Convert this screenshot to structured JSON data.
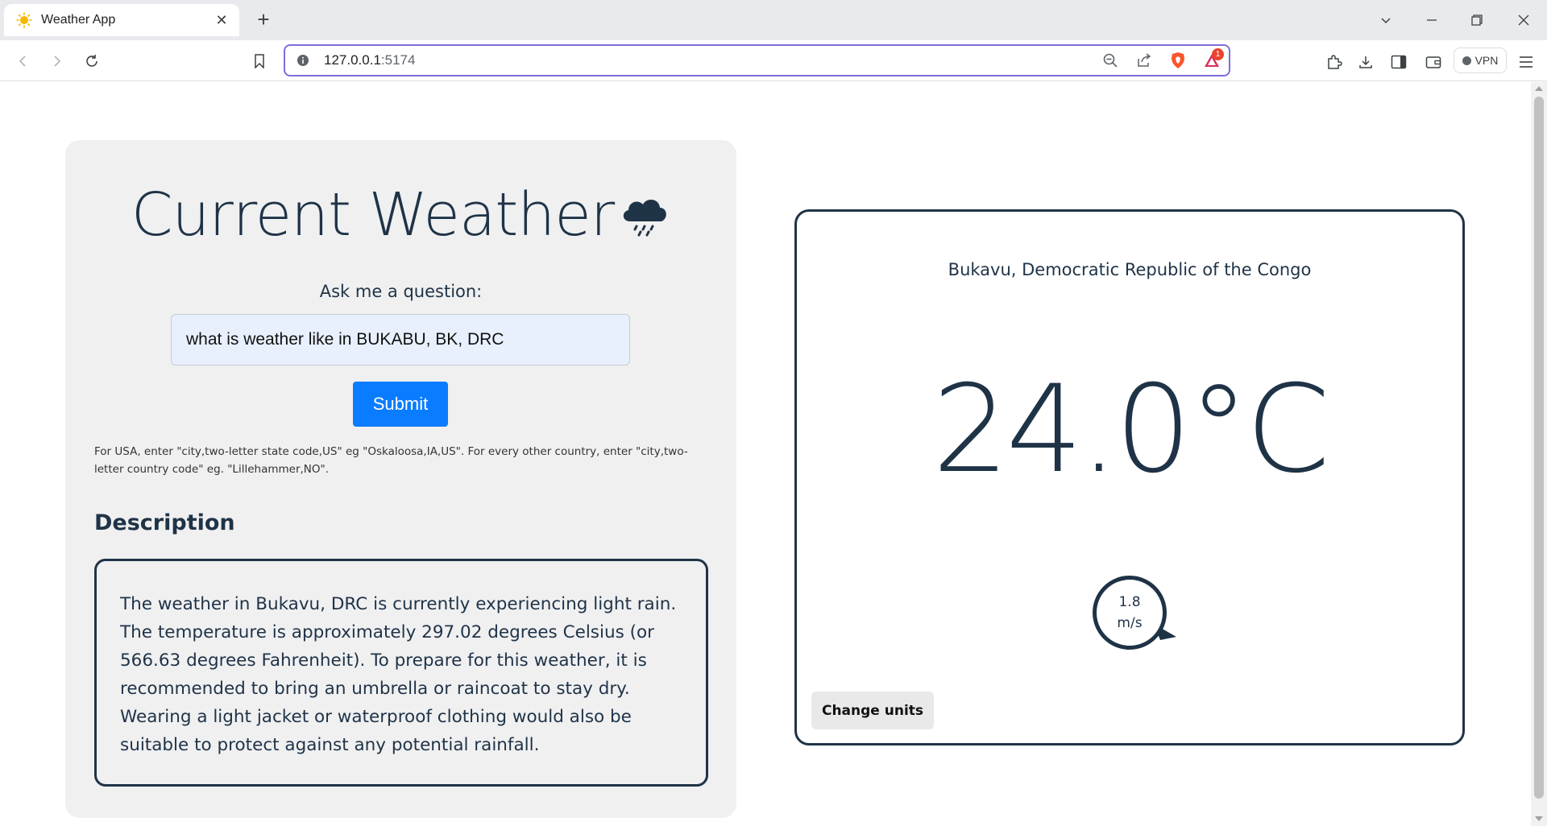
{
  "browser": {
    "tab_title": "Weather App",
    "tab_icon": "sun-icon",
    "new_tab_label": "+",
    "url_host": "127.0.0.1",
    "url_port": ":5174",
    "shield_badge_count": "1",
    "vpn_label": "VPN"
  },
  "page": {
    "heading": "Current Weather",
    "heading_icon": "rain-cloud-icon",
    "ask_label": "Ask me a question:",
    "question_value": "what is weather like in BUKABU, BK, DRC",
    "submit_label": "Submit",
    "hint": "For USA, enter \"city,two-letter state code,US\" eg \"Oskaloosa,IA,US\". For every other country, enter \"city,two-letter country code\" eg. \"Lillehammer,NO\".",
    "description_title": "Description",
    "description_text": "The weather in Bukavu, DRC is currently experiencing light rain. The temperature is approximately 297.02 degrees Celsius (or 566.63 degrees Fahrenheit). To prepare for this weather, it is recommended to bring an umbrella or raincoat to stay dry. Wearing a light jacket or waterproof clothing would also be suitable to protect against any potential rainfall."
  },
  "weather": {
    "location": "Bukavu, Democratic Republic of the Congo",
    "temperature": "24.0°C",
    "wind_speed": "1.8",
    "wind_unit": "m/s",
    "change_units_label": "Change units"
  },
  "colors": {
    "primary_text": "#1f3347",
    "submit": "#0a7cff",
    "card_bg": "#f0f0f1",
    "omnibox_border": "#7c6fdc"
  }
}
